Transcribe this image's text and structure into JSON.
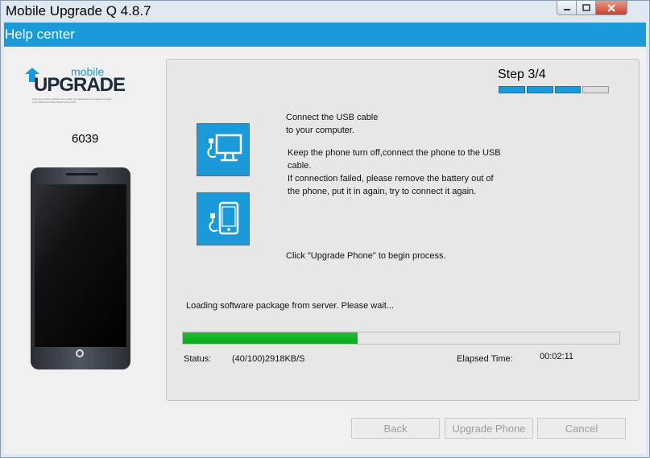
{
  "window": {
    "title": "Mobile Upgrade Q 4.8.7",
    "controls": {
      "minimize": "minimize-icon",
      "maximize": "maximize-icon",
      "close": "close-icon"
    }
  },
  "help_bar": {
    "label": "Help center"
  },
  "logo": {
    "mobile": "mobile",
    "upgrade": "UPGRADE",
    "tagline": "Keep your phone software up-to-date, just download the upgrade package from WWW.ALCATELONETOUCH.COM"
  },
  "device": {
    "model": "6039"
  },
  "step": {
    "label": "Step 3/4",
    "current": 3,
    "total": 4
  },
  "instructions": {
    "connect_line1": "Connect the USB cable",
    "connect_line2": "to your computer.",
    "phone_line1": "Keep the phone turn off,connect the phone to the USB",
    "phone_line2": "cable.",
    "phone_line3": "If connection failed, please remove the battery out of",
    "phone_line4": "the phone, put it in again, try to connect it again.",
    "click_line": "Click \"Upgrade Phone\" to begin process."
  },
  "icons": {
    "pc": "usb-to-pc-icon",
    "phone": "usb-to-phone-icon"
  },
  "status": {
    "loading": "Loading software package from server. Please wait...",
    "progress": 0.4,
    "status_label": "Status:",
    "status_value": "(40/100)2918KB/S",
    "elapsed_label": "Elapsed Time:",
    "elapsed_value": "00:02:11"
  },
  "buttons": {
    "back": "Back",
    "upgrade": "Upgrade Phone",
    "cancel": "Cancel"
  },
  "colors": {
    "accent": "#1a9ad8",
    "progress": "#12b322"
  }
}
